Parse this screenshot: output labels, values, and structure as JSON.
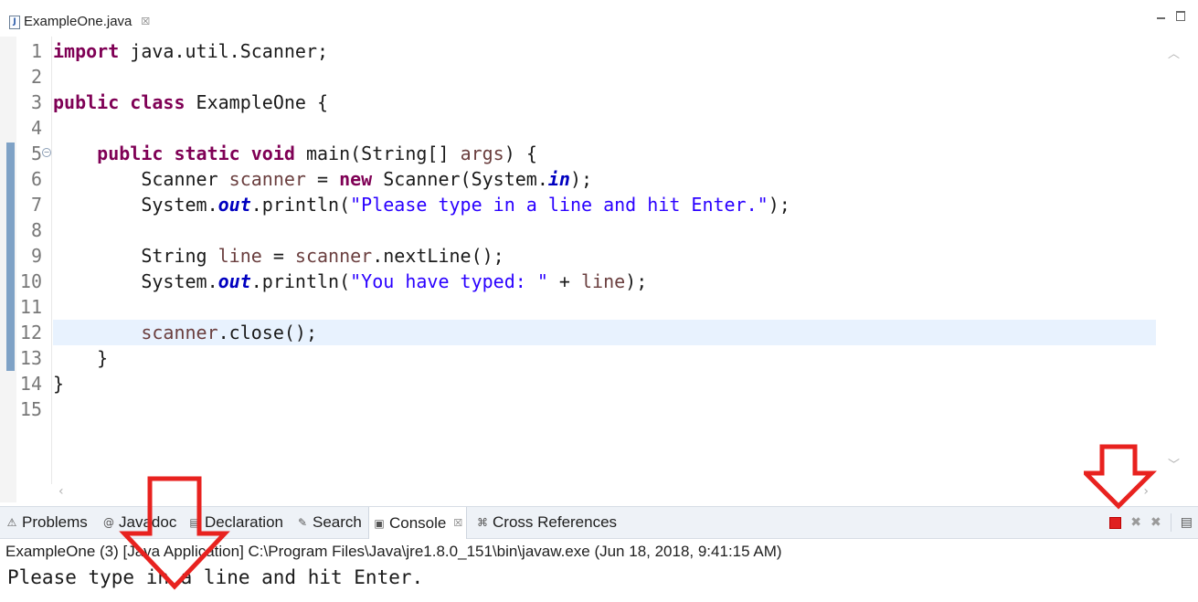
{
  "editor": {
    "tab_title": "ExampleOne.java",
    "tab_close": "☒",
    "file_icon": "J",
    "current_line": 12,
    "line_numbers": [
      "1",
      "2",
      "3",
      "4",
      "5",
      "6",
      "7",
      "8",
      "9",
      "10",
      "11",
      "12",
      "13",
      "14",
      "15"
    ],
    "code_lines": [
      [
        {
          "t": "import",
          "c": "kw"
        },
        {
          "t": " java.util.Scanner;",
          "c": ""
        }
      ],
      [],
      [
        {
          "t": "public",
          "c": "kw"
        },
        {
          "t": " ",
          "c": ""
        },
        {
          "t": "class",
          "c": "kw"
        },
        {
          "t": " ExampleOne {",
          "c": ""
        }
      ],
      [],
      [
        {
          "t": "    ",
          "c": ""
        },
        {
          "t": "public",
          "c": "kw"
        },
        {
          "t": " ",
          "c": ""
        },
        {
          "t": "static",
          "c": "kw"
        },
        {
          "t": " ",
          "c": ""
        },
        {
          "t": "void",
          "c": "kw"
        },
        {
          "t": " main(String[] ",
          "c": ""
        },
        {
          "t": "args",
          "c": "var"
        },
        {
          "t": ") {",
          "c": ""
        }
      ],
      [
        {
          "t": "        Scanner ",
          "c": ""
        },
        {
          "t": "scanner",
          "c": "var"
        },
        {
          "t": " = ",
          "c": ""
        },
        {
          "t": "new",
          "c": "kw"
        },
        {
          "t": " Scanner(System.",
          "c": ""
        },
        {
          "t": "in",
          "c": "static"
        },
        {
          "t": ");",
          "c": ""
        }
      ],
      [
        {
          "t": "        System.",
          "c": ""
        },
        {
          "t": "out",
          "c": "static"
        },
        {
          "t": ".println(",
          "c": ""
        },
        {
          "t": "\"Please type in a line and hit Enter.\"",
          "c": "str"
        },
        {
          "t": ");",
          "c": ""
        }
      ],
      [],
      [
        {
          "t": "        String ",
          "c": ""
        },
        {
          "t": "line",
          "c": "var"
        },
        {
          "t": " = ",
          "c": ""
        },
        {
          "t": "scanner",
          "c": "var"
        },
        {
          "t": ".nextLine();",
          "c": ""
        }
      ],
      [
        {
          "t": "        System.",
          "c": ""
        },
        {
          "t": "out",
          "c": "static"
        },
        {
          "t": ".println(",
          "c": ""
        },
        {
          "t": "\"You have typed: \"",
          "c": "str"
        },
        {
          "t": " + ",
          "c": ""
        },
        {
          "t": "line",
          "c": "var"
        },
        {
          "t": ");",
          "c": ""
        }
      ],
      [],
      [
        {
          "t": "        ",
          "c": ""
        },
        {
          "t": "scanner",
          "c": "var"
        },
        {
          "t": ".close();",
          "c": ""
        }
      ],
      [
        {
          "t": "    }",
          "c": ""
        }
      ],
      [
        {
          "t": "}",
          "c": ""
        }
      ],
      []
    ]
  },
  "panel": {
    "tabs": [
      {
        "label": "Problems",
        "icon": "problems-icon",
        "glyph": "⚠"
      },
      {
        "label": "Javadoc",
        "icon": "javadoc-icon",
        "glyph": "@"
      },
      {
        "label": "Declaration",
        "icon": "declaration-icon",
        "glyph": "▤"
      },
      {
        "label": "Search",
        "icon": "search-icon",
        "glyph": "✎"
      },
      {
        "label": "Console",
        "icon": "console-icon",
        "glyph": "▣",
        "active": true
      },
      {
        "label": "Cross References",
        "icon": "cross-references-icon",
        "glyph": "⌘"
      }
    ],
    "console_close": "☒"
  },
  "console": {
    "title": "ExampleOne (3) [Java Application] C:\\Program Files\\Java\\jre1.8.0_151\\bin\\javaw.exe (Jun 18, 2018, 9:41:15 AM)",
    "output": "Please type in a line and hit Enter."
  },
  "colors": {
    "keyword": "#7f0055",
    "string": "#2a00ff",
    "variable": "#6a3e3e",
    "static_field": "#0000c0",
    "annotation_arrow": "#e8221f",
    "stop_button": "#e02020",
    "current_line": "#e8f2fe"
  }
}
